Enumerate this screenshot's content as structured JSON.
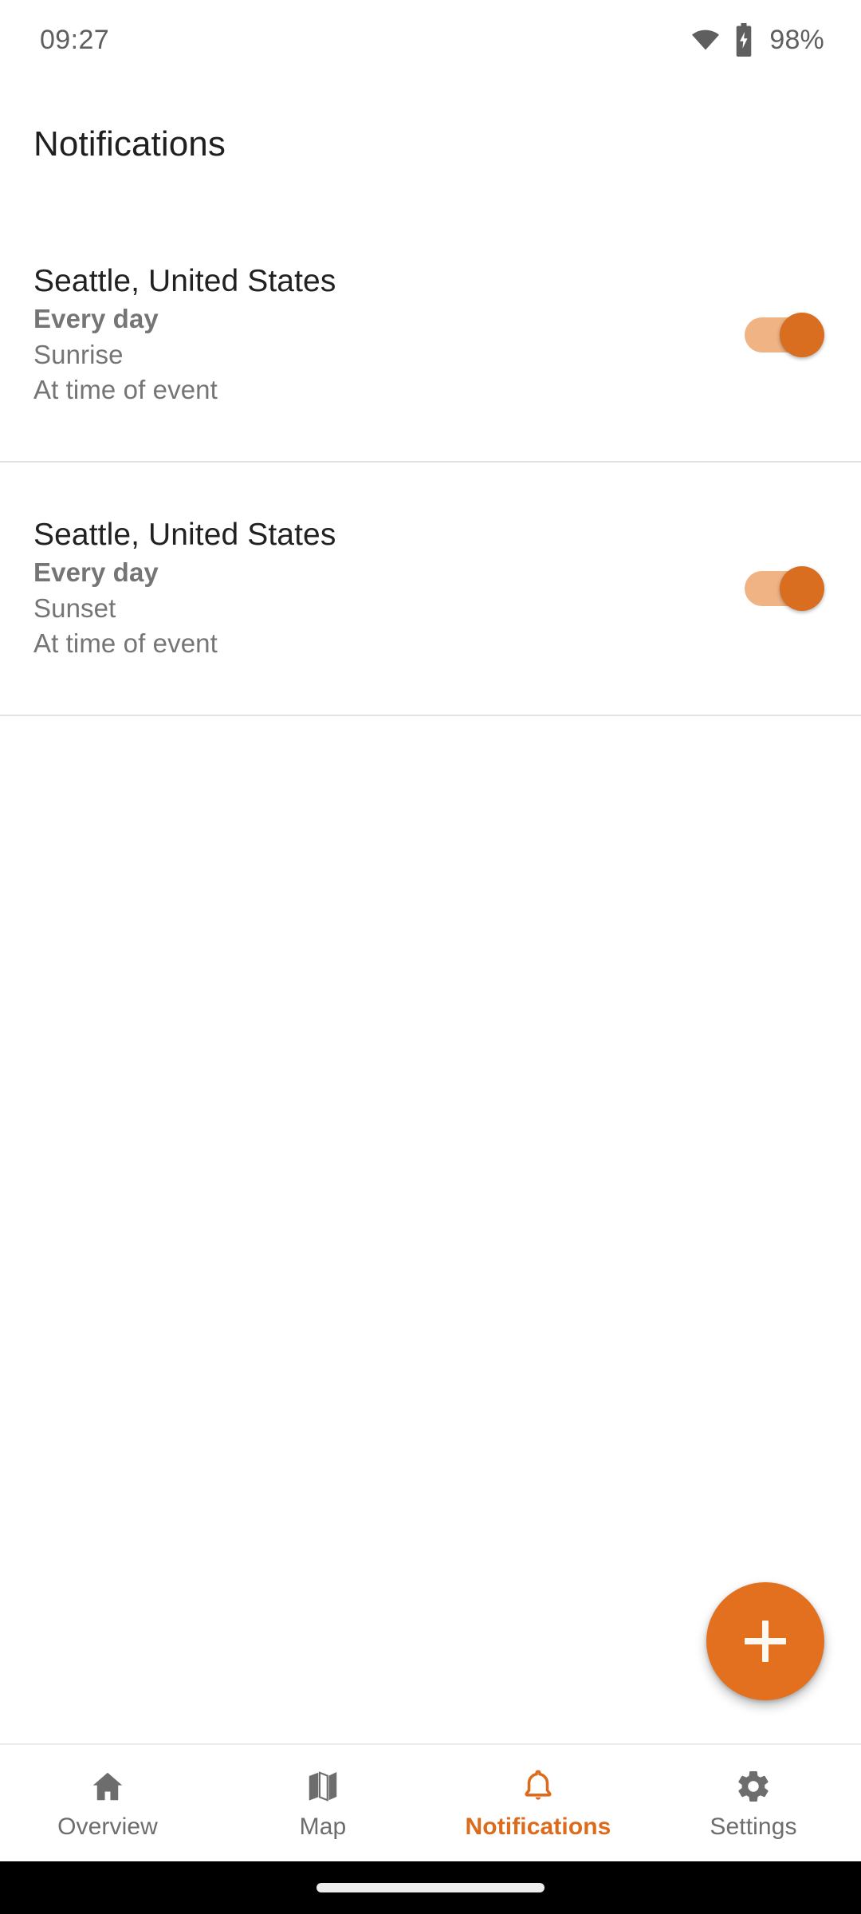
{
  "status_bar": {
    "time": "09:27",
    "battery_percent": "98%",
    "wifi_icon": "wifi-icon",
    "battery_icon": "battery-charging-icon"
  },
  "app_bar": {
    "title": "Notifications"
  },
  "colors": {
    "accent": "#e2701f",
    "accent_track": "#efb384",
    "accent_thumb": "#d96d20",
    "nav_active": "#dd6b1c",
    "nav_inactive": "#6d6d6d",
    "primary_text": "#212121",
    "secondary_text": "#757575",
    "divider": "#e2e2e2",
    "background": "#ffffff"
  },
  "notifications": [
    {
      "location": "Seattle, United States",
      "repeat": "Every day",
      "event": "Sunrise",
      "offset": "At time of event",
      "enabled": true,
      "toggle_state": "on"
    },
    {
      "location": "Seattle, United States",
      "repeat": "Every day",
      "event": "Sunset",
      "offset": "At time of event",
      "enabled": true,
      "toggle_state": "on"
    }
  ],
  "fab": {
    "label": "+",
    "icon": "plus-icon",
    "action": "add-notification"
  },
  "bottom_nav": {
    "active_index": 2,
    "items": [
      {
        "label": "Overview",
        "icon": "home-icon",
        "active": false
      },
      {
        "label": "Map",
        "icon": "map-icon",
        "active": false
      },
      {
        "label": "Notifications",
        "icon": "bell-icon",
        "active": true
      },
      {
        "label": "Settings",
        "icon": "gear-icon",
        "active": false
      }
    ]
  },
  "gesture_bar": {
    "handle": "home-gesture-pill"
  }
}
